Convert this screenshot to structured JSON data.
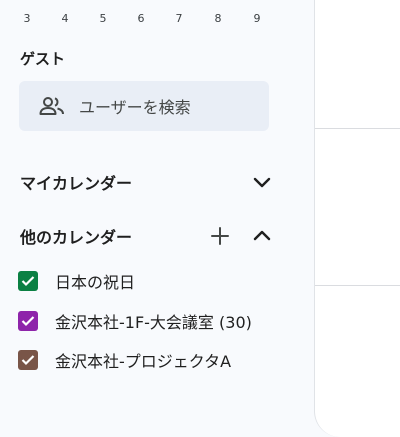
{
  "mini_calendar": {
    "days": [
      "3",
      "4",
      "5",
      "6",
      "7",
      "8",
      "9"
    ]
  },
  "guest": {
    "label": "ゲスト",
    "search_placeholder": "ユーザーを検索",
    "icon": "people-icon"
  },
  "my_calendars": {
    "title": "マイカレンダー",
    "toggle_icon": "chevron-down-icon"
  },
  "other_calendars": {
    "title": "他のカレンダー",
    "add_icon": "plus-icon",
    "toggle_icon": "chevron-up-icon",
    "items": [
      {
        "label": "日本の祝日",
        "color": "#0b8043",
        "checked": true
      },
      {
        "label": "金沢本社-1F-大会議室 (30)",
        "color": "#8e24aa",
        "checked": true
      },
      {
        "label": "金沢本社-プロジェクタA",
        "color": "#795548",
        "checked": true
      }
    ]
  }
}
